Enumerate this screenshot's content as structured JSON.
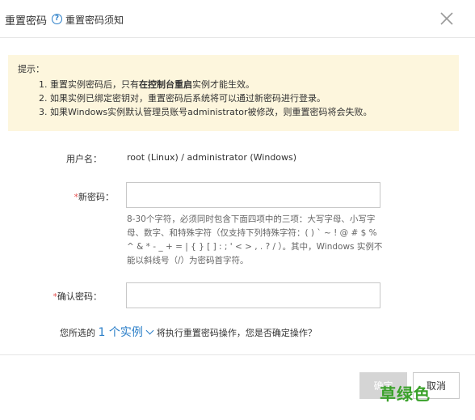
{
  "header": {
    "title": "重置密码",
    "help_icon": "question-icon",
    "help_link": "重置密码须知",
    "close_icon": "close-icon"
  },
  "tips": {
    "title": "提示：",
    "items": [
      {
        "before": "1. 重置实例密码后，只有",
        "bold": "在控制台重启",
        "after": "实例才能生效。"
      },
      {
        "before": "2. 如果实例已绑定密钥对，重置密码后系统将可以通过新密码进行登录。",
        "bold": "",
        "after": ""
      },
      {
        "before": "3. 如果Windows实例默认管理员账号administrator被修改，则重置密码将会失败。",
        "bold": "",
        "after": ""
      }
    ]
  },
  "form": {
    "username_label": "用户名：",
    "username_value": "root (Linux) / administrator (Windows)",
    "new_password_required": "*",
    "new_password_label": "新密码：",
    "new_password_value": "",
    "password_hint": "8-30个字符，必须同时包含下面四项中的三项：大写字母、小写字母、数字、和特殊字符（仅支持下列特殊字符：( ) ` ~ ! @ # $ % ^ & * - _ + = | { } [ ] : ; ' < > , . ? / ）。其中，Windows 实例不能以斜线号（/）为密码首字符。",
    "confirm_password_required": "*",
    "confirm_password_label": "确认密码：",
    "confirm_password_value": ""
  },
  "confirm": {
    "before": "您所选的",
    "instance_link": "1 个实例",
    "after": "将执行重置密码操作，您是否确定操作？"
  },
  "footer": {
    "ok_label": "确定",
    "cancel_label": "取消"
  },
  "watermark": "草绿色",
  "colors": {
    "accent": "#2a7ec8",
    "tips_bg": "#fdf6dd",
    "required": "#e45050",
    "disabled_button": "#d5d5d5",
    "watermark": "#3aa12a"
  }
}
